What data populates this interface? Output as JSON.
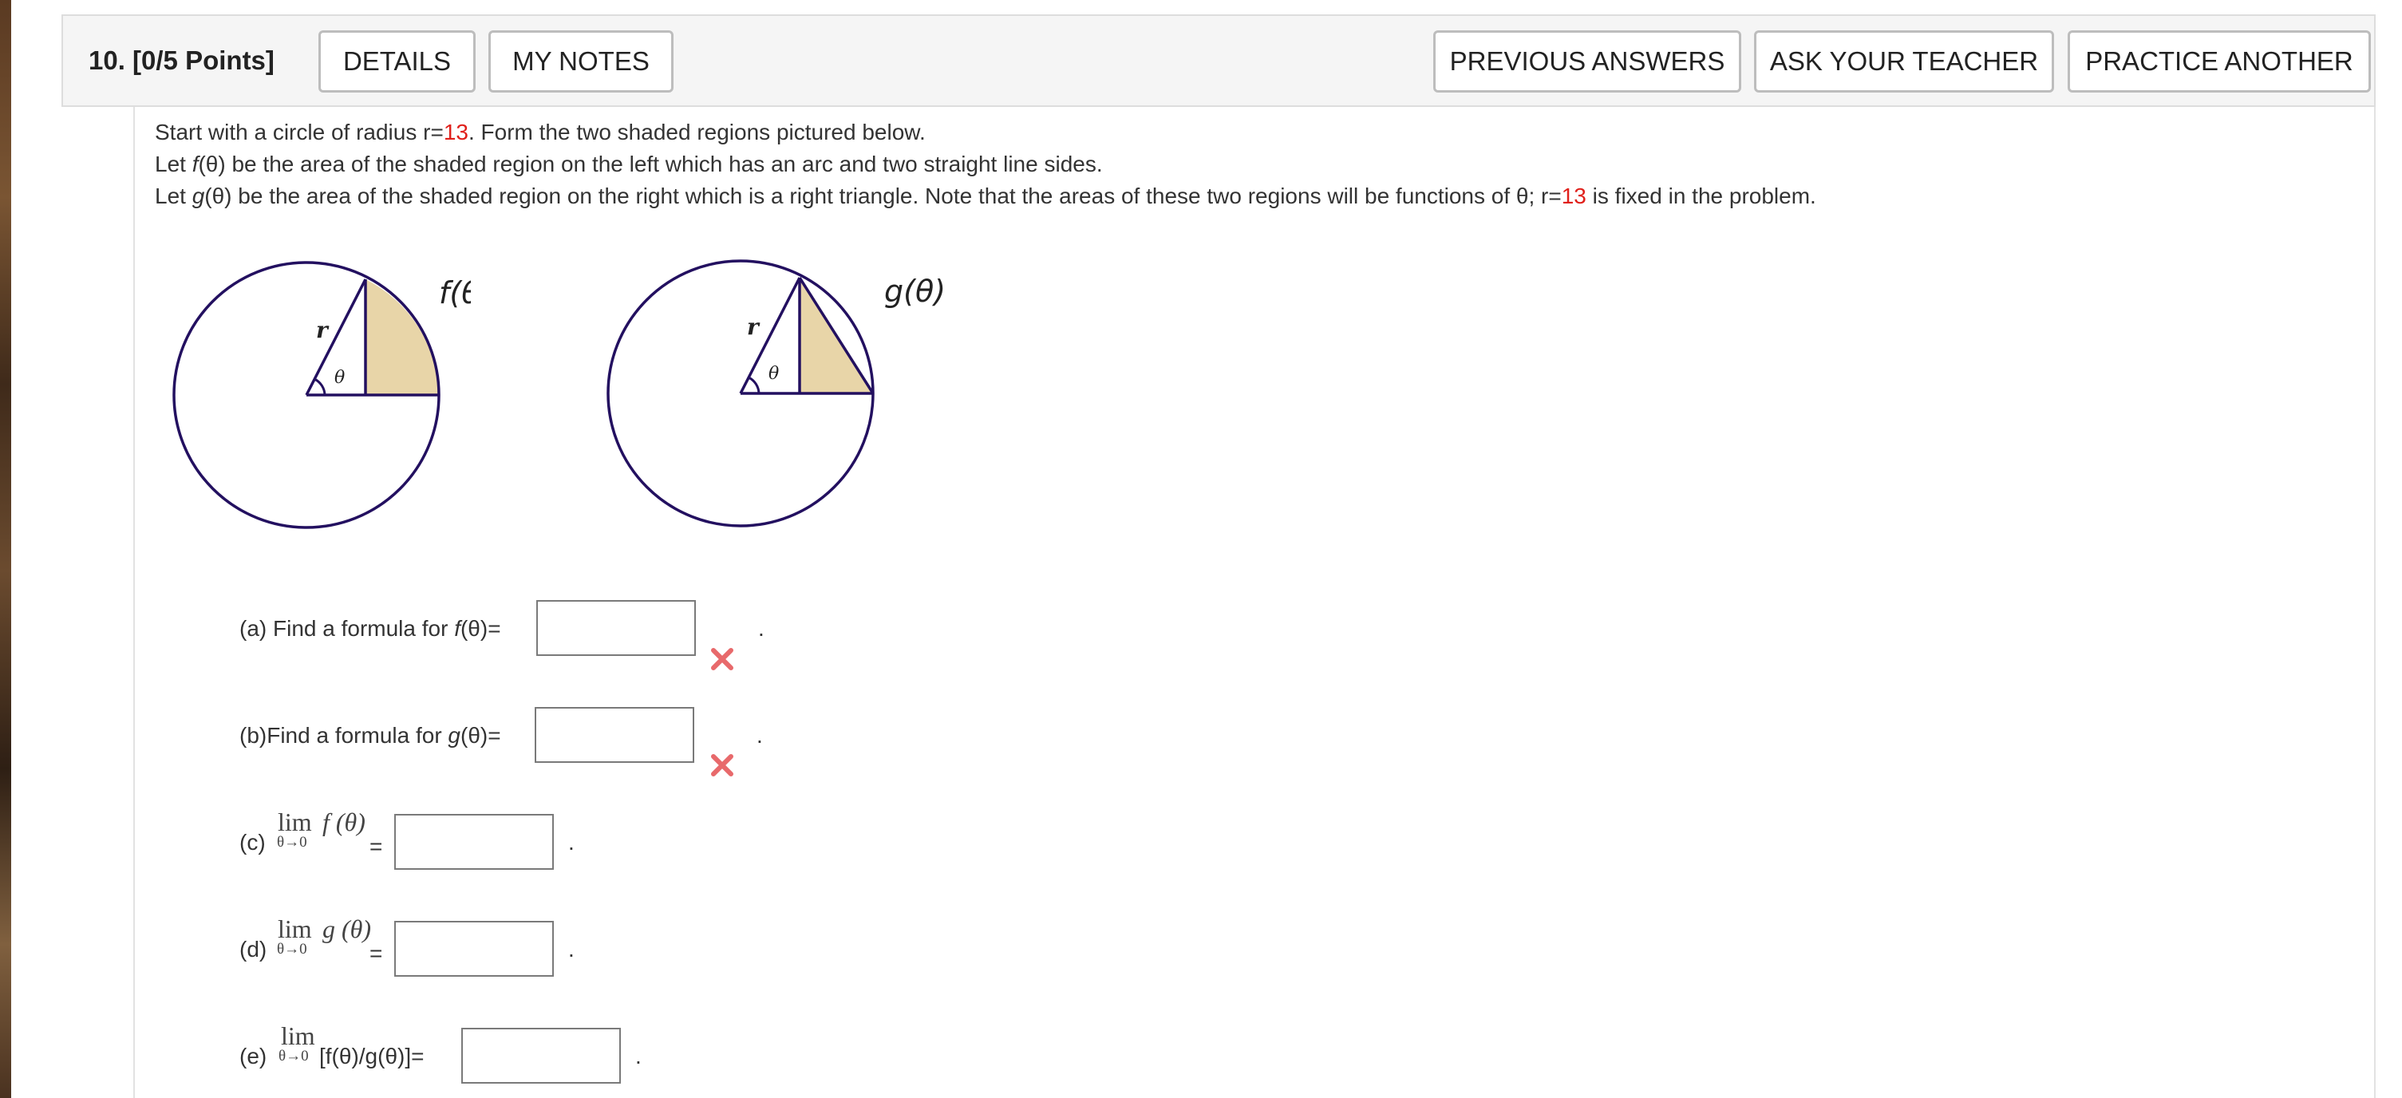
{
  "header": {
    "question_label": "10.  [0/5 Points]",
    "buttons": {
      "details": "DETAILS",
      "my_notes": "MY NOTES",
      "previous_answers": "PREVIOUS ANSWERS",
      "ask_teacher": "ASK YOUR TEACHER",
      "practice_another": "PRACTICE ANOTHER"
    }
  },
  "problem": {
    "line1_a": "Start with a circle of radius r=",
    "radius": "13",
    "line1_b": ". Form the two shaded regions pictured below.",
    "line2_a": "Let ",
    "line2_f": "f",
    "line2_b": "(θ) be the area of the shaded region on the left which has an arc and two straight line sides.",
    "line3_a": "Let ",
    "line3_g": "g",
    "line3_b": "(θ) be the area of the shaded region on the right which is a right triangle. Note that the areas of these two regions will be functions of θ; r=",
    "line3_c": " is fixed in the problem."
  },
  "figures": {
    "left_label": "f(θ)",
    "right_label": "g(θ)",
    "radius_label": "r",
    "angle_label": "θ",
    "shade_color": "#e8d5a8",
    "stroke_color": "#231060"
  },
  "parts": {
    "a_label": "(a) Find a formula for ",
    "a_func": "f",
    "a_tail": "(θ)=",
    "b_label": "(b)Find a formula for ",
    "b_func": "g",
    "b_tail": "(θ)=",
    "c_label": "(c)",
    "c_lim": "lim",
    "c_sub": "θ→0",
    "c_expr": "f (θ)",
    "d_label": "(d)",
    "d_lim": "lim",
    "d_sub": "θ→0",
    "d_expr": "g (θ)",
    "e_label": "(e)",
    "e_lim": "lim",
    "e_sub": "θ→0",
    "e_expr": " [f(θ)/g(θ)]=",
    "equals": "=",
    "period": "."
  },
  "status_icons": {
    "incorrect": "x-mark-icon",
    "incorrect_color": "#e8696b"
  }
}
